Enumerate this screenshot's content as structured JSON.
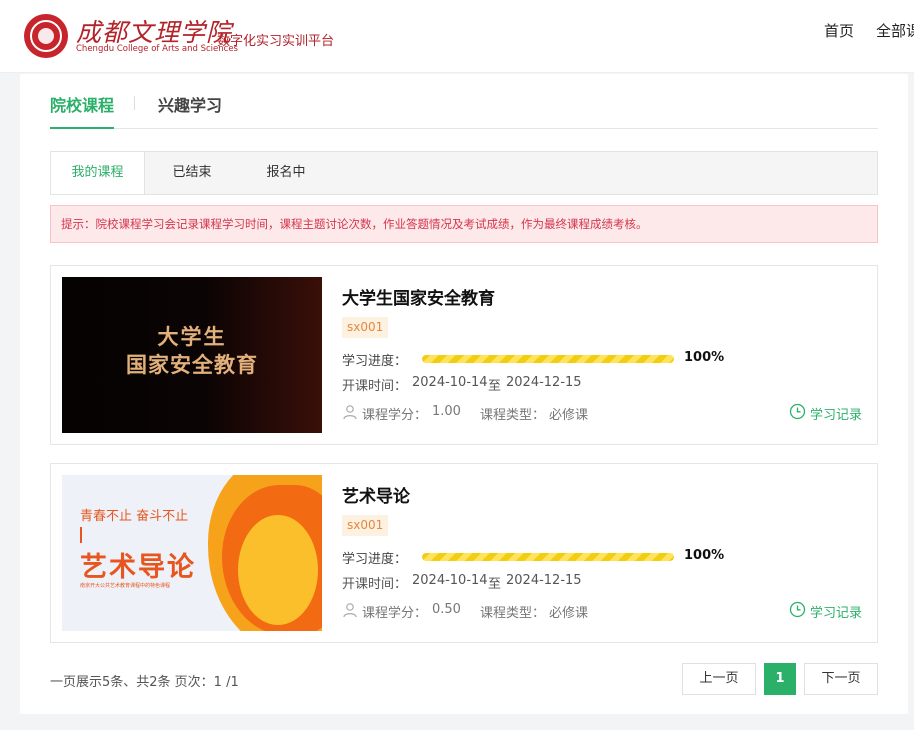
{
  "header": {
    "school_name_cn": "成都文理学院",
    "school_name_en": "Chengdu College of Arts and Sciences",
    "platform_name": "数字化实习实训平台",
    "nav": [
      "首页",
      "全部课程"
    ],
    "brand_color": "#b2232a"
  },
  "tabs": {
    "active": "院校课程",
    "other": "兴趣学习"
  },
  "subtabs": [
    "我的课程",
    "已结束",
    "报名中"
  ],
  "notice": "提示：院校课程学习会记录课程学习时间，课程主题讨论次数，作业答题情况及考试成绩，作为最终课程成绩考核。",
  "labels": {
    "progress": "学习进度：",
    "time": "开课时间：",
    "to": "至",
    "credit": "课程学分：",
    "type": "课程类型：",
    "record": "学习记录"
  },
  "courses": [
    {
      "title": "大学生国家安全教育",
      "code": "sx001",
      "progress": 1.0,
      "progress_text": "100%",
      "start": "2024-10-14",
      "end": "2024-12-15",
      "credit": "1.00",
      "type": "必修课",
      "thumb_text": [
        "大学生",
        "国家安全教育"
      ]
    },
    {
      "title": "艺术导论",
      "code": "sx001",
      "progress": 1.0,
      "progress_text": "100%",
      "start": "2024-10-14",
      "end": "2024-12-15",
      "credit": "0.50",
      "type": "必修课",
      "thumb_text": [
        "青春不止 奋斗不止",
        "艺术导论",
        "南京开大公共艺术教育课程中的特色课程"
      ]
    }
  ],
  "pager": {
    "info": "一页展示5条、共2条 页次：1 /1",
    "prev": "上一页",
    "current": "1",
    "next": "下一页"
  },
  "colors": {
    "accent": "#2bb06a",
    "notice_text": "#d4364a",
    "progress": "#f3cd10"
  }
}
